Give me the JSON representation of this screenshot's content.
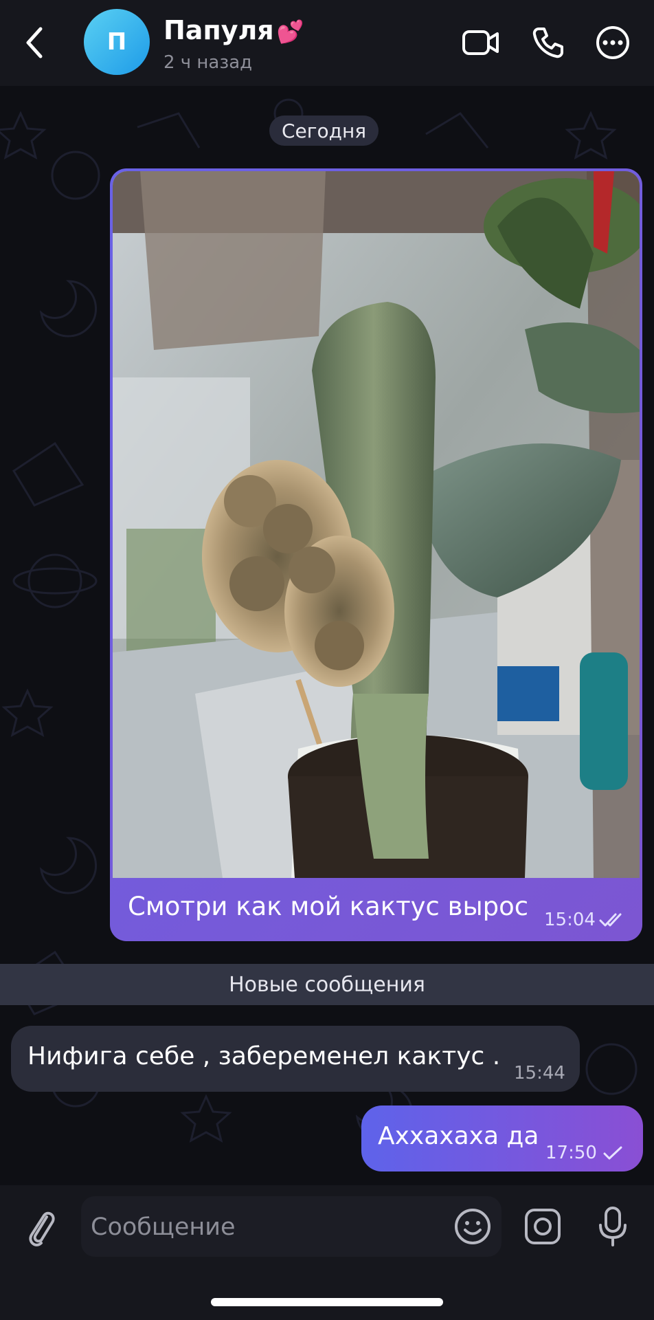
{
  "colors": {
    "background": "#0e0f14",
    "header": "#16171d",
    "outgoing_bubble_start": "#5e63ea",
    "outgoing_bubble_end": "#8a4fd4",
    "incoming_bubble": "#2b2d3a",
    "avatar": "#1e9be8"
  },
  "header": {
    "back_icon": "chevron-left-icon",
    "avatar_letter": "П",
    "contact_name": "Папуля",
    "name_emoji": "💕",
    "status": "2 ч назад",
    "video_icon": "video-camera-icon",
    "call_icon": "phone-icon",
    "more_icon": "more-horizontal-icon"
  },
  "chat": {
    "date_label": "Сегодня",
    "new_messages_label": "Новые сообщения",
    "messages": [
      {
        "direction": "outgoing",
        "type": "photo",
        "photo_subject": "cactus",
        "text": "Смотри как мой кактус вырос",
        "time": "15:04",
        "status": "read"
      },
      {
        "direction": "incoming",
        "type": "text",
        "text": "Нифига себе , забеременел кактус .",
        "time": "15:44"
      },
      {
        "direction": "outgoing",
        "type": "text",
        "text": "Аххахаха да",
        "time": "17:50",
        "status": "sent"
      }
    ]
  },
  "input": {
    "placeholder": "Сообщение",
    "value": "",
    "attach_icon": "paperclip-icon",
    "emoji_icon": "emoji-icon",
    "camera_icon": "instagram-camera-icon",
    "mic_icon": "microphone-icon"
  }
}
